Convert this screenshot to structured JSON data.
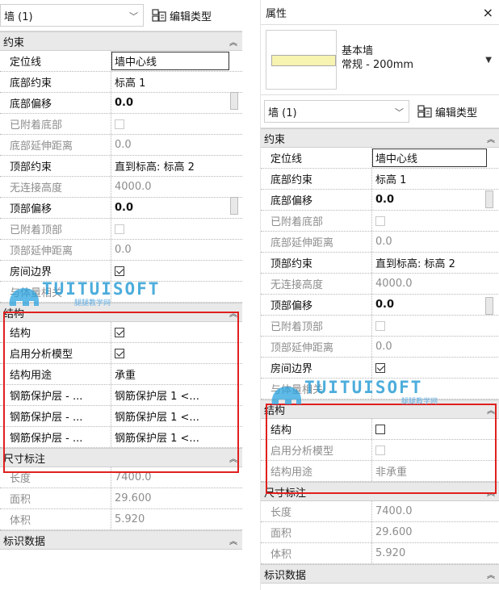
{
  "left": {
    "type_selector": "墙 (1)",
    "edit_type_label": "编辑类型",
    "sections": {
      "constraints": "约束",
      "structure": "结构",
      "dimensions": "尺寸标注",
      "identity": "标识数据"
    },
    "constraints_rows": [
      {
        "label": "定位线",
        "value": "墙中心线"
      },
      {
        "label": "底部约束",
        "value": "标高 1"
      },
      {
        "label": "底部偏移",
        "value": "0.0"
      },
      {
        "label": "已附着底部",
        "value": ""
      },
      {
        "label": "底部延伸距离",
        "value": "0.0"
      },
      {
        "label": "顶部约束",
        "value": "直到标高: 标高 2"
      },
      {
        "label": "无连接高度",
        "value": "4000.0"
      },
      {
        "label": "顶部偏移",
        "value": "0.0"
      },
      {
        "label": "已附着顶部",
        "value": ""
      },
      {
        "label": "顶部延伸距离",
        "value": "0.0"
      },
      {
        "label": "房间边界",
        "value": ""
      },
      {
        "label": "与体量相关",
        "value": ""
      }
    ],
    "structure_rows": [
      {
        "label": "结构",
        "value": ""
      },
      {
        "label": "启用分析模型",
        "value": ""
      },
      {
        "label": "结构用途",
        "value": "承重"
      },
      {
        "label": "钢筋保护层 - ...",
        "value": "钢筋保护层 1 <..."
      },
      {
        "label": "钢筋保护层 - ...",
        "value": "钢筋保护层 1 <..."
      },
      {
        "label": "钢筋保护层 - ...",
        "value": "钢筋保护层 1 <..."
      }
    ],
    "dimension_rows": [
      {
        "label": "长度",
        "value": "7400.0"
      },
      {
        "label": "面积",
        "value": "29.600"
      },
      {
        "label": "体积",
        "value": "5.920"
      }
    ]
  },
  "right": {
    "title": "属性",
    "close_glyph": "×",
    "family_name": "基本墙",
    "type_name": "常规 - 200mm",
    "type_selector": "墙 (1)",
    "edit_type_label": "编辑类型",
    "sections": {
      "constraints": "约束",
      "structure": "结构",
      "dimensions": "尺寸标注",
      "identity": "标识数据"
    },
    "constraints_rows": [
      {
        "label": "定位线",
        "value": "墙中心线"
      },
      {
        "label": "底部约束",
        "value": "标高 1"
      },
      {
        "label": "底部偏移",
        "value": "0.0"
      },
      {
        "label": "已附着底部",
        "value": ""
      },
      {
        "label": "底部延伸距离",
        "value": "0.0"
      },
      {
        "label": "顶部约束",
        "value": "直到标高: 标高 2"
      },
      {
        "label": "无连接高度",
        "value": "4000.0"
      },
      {
        "label": "顶部偏移",
        "value": "0.0"
      },
      {
        "label": "已附着顶部",
        "value": ""
      },
      {
        "label": "顶部延伸距离",
        "value": "0.0"
      },
      {
        "label": "房间边界",
        "value": ""
      },
      {
        "label": "与体量相关",
        "value": ""
      }
    ],
    "structure_rows": [
      {
        "label": "结构",
        "value": ""
      },
      {
        "label": "启用分析模型",
        "value": ""
      },
      {
        "label": "结构用途",
        "value": "非承重"
      }
    ],
    "dimension_rows": [
      {
        "label": "长度",
        "value": "7400.0"
      },
      {
        "label": "面积",
        "value": "29.600"
      },
      {
        "label": "体积",
        "value": "5.920"
      }
    ]
  },
  "watermark": {
    "brand": "TUITUISOFT",
    "tagline": "腿腿教学网"
  },
  "colors": {
    "highlight_border": "#e0201e",
    "section_bg": "#e9e9e9",
    "watermark_blue": "#2e9fd6"
  }
}
